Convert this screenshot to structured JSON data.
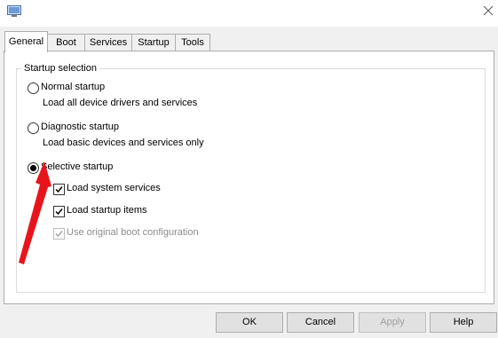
{
  "window": {
    "icon": "msconfig-icon",
    "close": "close-icon"
  },
  "tabs": [
    {
      "label": "General",
      "active": true
    },
    {
      "label": "Boot",
      "active": false
    },
    {
      "label": "Services",
      "active": false
    },
    {
      "label": "Startup",
      "active": false
    },
    {
      "label": "Tools",
      "active": false
    }
  ],
  "startup_selection": {
    "title": "Startup selection",
    "normal": {
      "label": "Normal startup",
      "desc": "Load all device drivers and services",
      "selected": false
    },
    "diagnostic": {
      "label": "Diagnostic startup",
      "desc": "Load basic devices and services only",
      "selected": false
    },
    "selective": {
      "label": "Selective startup",
      "selected": true,
      "options": [
        {
          "label": "Load system services",
          "checked": true,
          "enabled": true
        },
        {
          "label": "Load startup items",
          "checked": true,
          "enabled": true
        },
        {
          "label": "Use original boot configuration",
          "checked": true,
          "enabled": false
        }
      ]
    }
  },
  "annotation": {
    "arrow_color": "#e8141c"
  },
  "buttons": {
    "ok": "OK",
    "cancel": "Cancel",
    "apply": "Apply",
    "help": "Help"
  }
}
